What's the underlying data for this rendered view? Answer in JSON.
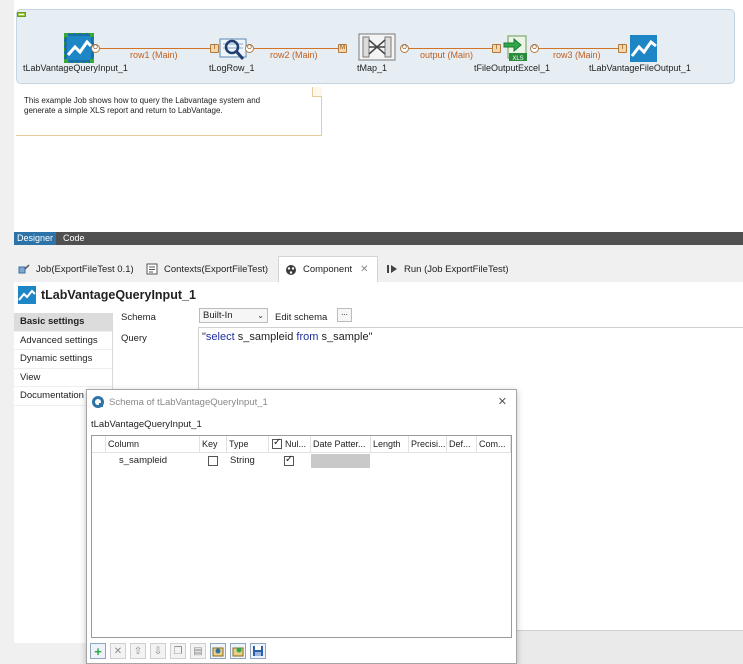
{
  "job_design": {
    "components": [
      {
        "id": "tLabVantageQueryInput_1",
        "label": "tLabVantageQueryInput_1",
        "icon": "labvantage-icon"
      },
      {
        "id": "tLogRow_1",
        "label": "tLogRow_1",
        "icon": "log-row-icon"
      },
      {
        "id": "tMap_1",
        "label": "tMap_1",
        "icon": "map-icon"
      },
      {
        "id": "tFileOutputExcel_1",
        "label": "tFileOutputExcel_1",
        "icon": "excel-output-icon"
      },
      {
        "id": "tLabVantageFileOutput_1",
        "label": "tLabVantageFileOutput_1",
        "icon": "labvantage-icon"
      }
    ],
    "connections": [
      {
        "label": "row1 (Main)"
      },
      {
        "label": "row2 (Main)"
      },
      {
        "label": "output (Main)"
      },
      {
        "label": "row3 (Main)"
      }
    ],
    "note": "This example Job shows how to query the Labvantage system and\ngenerate a simple XLS report and return to LabVantage."
  },
  "editor_tabs": {
    "designer": "Designer",
    "code": "Code"
  },
  "view_tabs": [
    {
      "label": "Job(ExportFileTest 0.1)",
      "icon": "job-icon"
    },
    {
      "label": "Contexts(ExportFileTest)",
      "icon": "contexts-icon"
    },
    {
      "label": "Component",
      "icon": "component-icon",
      "active": true
    },
    {
      "label": "Run (Job ExportFileTest)",
      "icon": "run-icon"
    }
  ],
  "component_panel": {
    "title": "tLabVantageQueryInput_1",
    "nav": [
      "Basic settings",
      "Advanced settings",
      "Dynamic settings",
      "View",
      "Documentation"
    ],
    "schema_label": "Schema",
    "schema_value": "Built-In",
    "edit_schema_label": "Edit schema",
    "edit_schema_button": "...",
    "query_label": "Query",
    "query": {
      "quote_open": "\"",
      "kw_select": "select",
      "column": "s_sampleid",
      "kw_from": "from",
      "table": "s_sample",
      "quote_close": "\""
    }
  },
  "schema_dialog": {
    "title": "Schema of tLabVantageQueryInput_1",
    "subtitle": "tLabVantageQueryInput_1",
    "columns": [
      "Column",
      "Key",
      "Type",
      "Nul...",
      "Date Patter...",
      "Length",
      "Precisi...",
      "Def...",
      "Com..."
    ],
    "nullable_header_checked": true,
    "rows": [
      {
        "column": "s_sampleid",
        "key": false,
        "type": "String",
        "nullable": true
      }
    ],
    "toolbar": [
      "add-icon",
      "remove-icon",
      "move-up-icon",
      "move-down-icon",
      "copy-icon",
      "paste-icon",
      "import-icon",
      "export-icon",
      "save-icon"
    ]
  },
  "colors": {
    "accent": "#2d73a8",
    "connection": "#c25e1e",
    "subjob_bg": "#e6eef4"
  }
}
